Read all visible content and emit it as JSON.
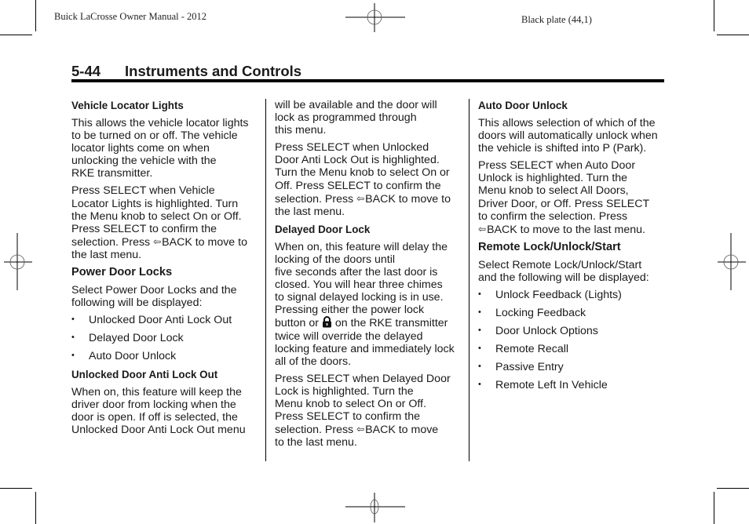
{
  "header": {
    "manual_title": "Buick LaCrosse Owner Manual - 2012",
    "plate": "Black plate (44,1)"
  },
  "page": {
    "number": "5-44",
    "section_title": "Instruments and Controls"
  },
  "icons": {
    "back_arrow": "⇦",
    "lock": "lock-icon"
  },
  "col1": {
    "vehicle_locator_heading": "Vehicle Locator Lights",
    "vehicle_locator_p1": "This allows the vehicle locator lights\nto be turned on or off. The vehicle\nlocator lights come on when\nunlocking the vehicle with the\nRKE transmitter.",
    "vehicle_locator_p2a": "Press SELECT when Vehicle\nLocator Lights is highlighted. Turn\nthe Menu knob to select On or Off.\nPress SELECT to confirm the\nselection. Press ",
    "vehicle_locator_p2b": "BACK to move to\nthe last menu.",
    "power_door_heading": "Power Door Locks",
    "power_door_p1": "Select Power Door Locks and the\nfollowing will be displayed:",
    "power_door_items": [
      "Unlocked Door Anti Lock Out",
      "Delayed Door Lock",
      "Auto Door Unlock"
    ],
    "anti_lock_heading": "Unlocked Door Anti Lock Out",
    "anti_lock_p1": "When on, this feature will keep the\ndriver door from locking when the\ndoor is open. If off is selected, the\nUnlocked Door Anti Lock Out menu"
  },
  "col2": {
    "anti_lock_p1_cont": "will be available and the door will\nlock as programmed through\nthis menu.",
    "anti_lock_p2a": "Press SELECT when Unlocked\nDoor Anti Lock Out is highlighted.\nTurn the Menu knob to select On or\nOff. Press SELECT to confirm the\nselection. Press ",
    "anti_lock_p2b": "BACK to move to\nthe last menu.",
    "delayed_heading": "Delayed Door Lock",
    "delayed_p1a": "When on, this feature will delay the\nlocking of the doors until\nfive seconds after the last door is\nclosed. You will hear three chimes\nto signal delayed locking is in use.\nPressing either the power lock\nbutton or ",
    "delayed_p1b": " on the RKE transmitter\ntwice will override the delayed\nlocking feature and immediately lock\nall of the doors.",
    "delayed_p2a": "Press SELECT when Delayed Door\nLock is highlighted. Turn the\nMenu knob to select On or Off.\nPress SELECT to confirm the\nselection. Press ",
    "delayed_p2b": "BACK to move\nto the last menu."
  },
  "col3": {
    "auto_unlock_heading": "Auto Door Unlock",
    "auto_unlock_p1": "This allows selection of which of the\ndoors will automatically unlock when\nthe vehicle is shifted into P (Park).",
    "auto_unlock_p2a": "Press SELECT when Auto Door\nUnlock is highlighted. Turn the\nMenu knob to select All Doors,\nDriver Door, or Off. Press SELECT\nto confirm the selection. Press\n",
    "auto_unlock_p2b": "BACK to move to the last menu.",
    "remote_heading": "Remote Lock/Unlock/Start",
    "remote_p1": "Select Remote Lock/Unlock/Start\nand the following will be displayed:",
    "remote_items": [
      "Unlock Feedback (Lights)",
      "Locking Feedback",
      "Door Unlock Options",
      "Remote Recall",
      "Passive Entry",
      "Remote Left In Vehicle"
    ]
  }
}
